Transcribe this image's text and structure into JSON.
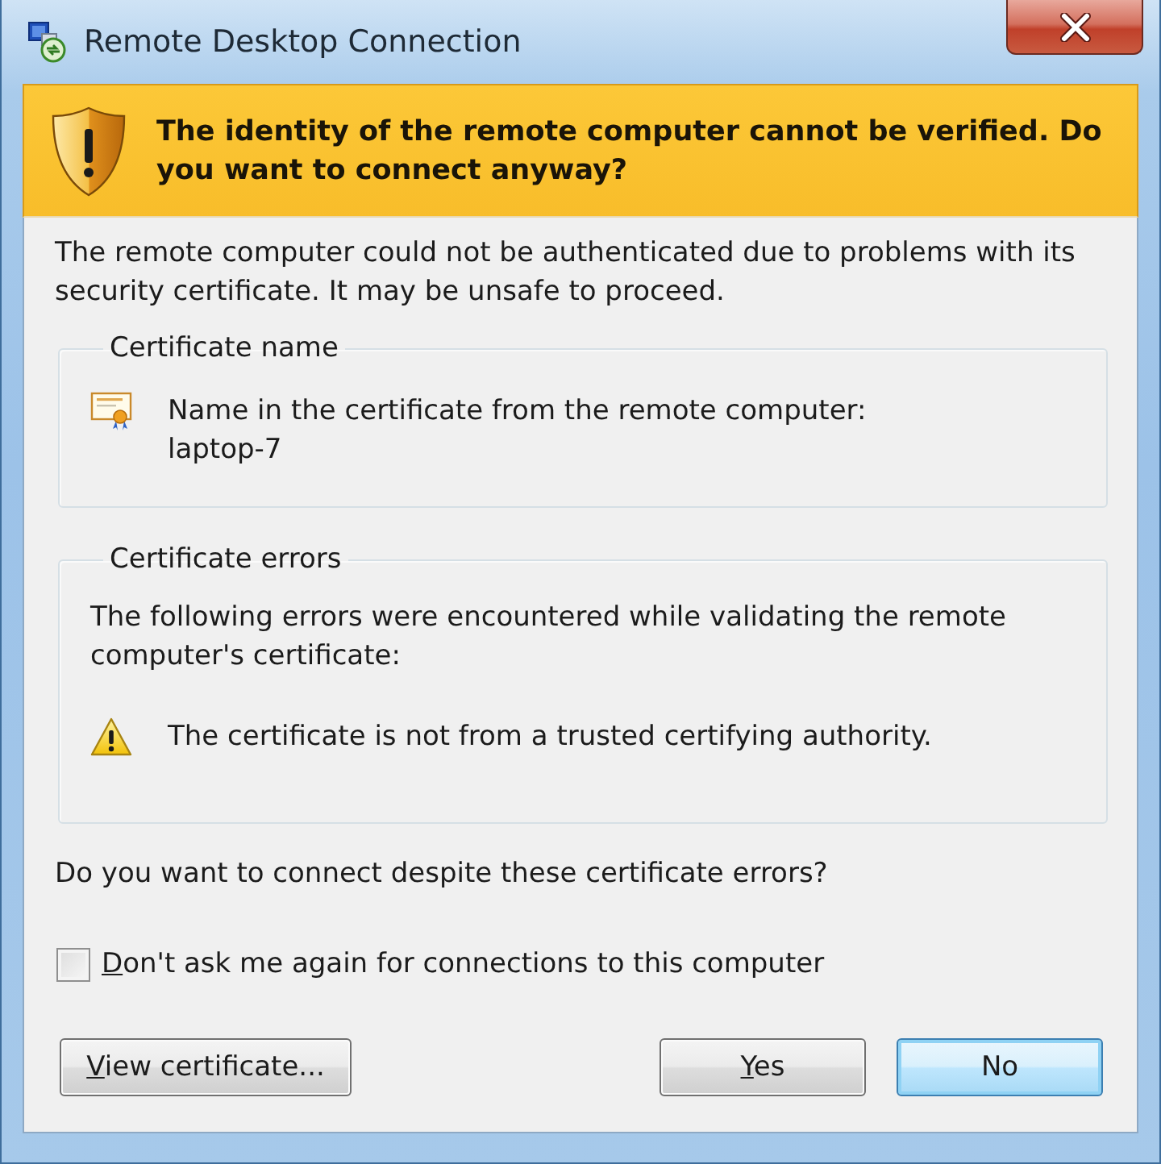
{
  "window": {
    "title": "Remote Desktop Connection"
  },
  "banner": {
    "text": "The identity of the remote computer cannot be verified. Do you want to connect anyway?"
  },
  "message": "The remote computer could not be authenticated due to problems with its security certificate. It may be unsafe to proceed.",
  "certificate_name": {
    "title": "Certificate name",
    "label": "Name in the certificate from the remote computer:",
    "value": "laptop-7"
  },
  "certificate_errors": {
    "title": "Certificate errors",
    "intro": "The following errors were encountered while validating the remote computer's certificate:",
    "errors": [
      "The certificate is not from a trusted certifying authority."
    ]
  },
  "question": "Do you want to connect despite these certificate errors?",
  "checkbox": {
    "label": "Don't ask me again for connections to this computer",
    "checked": false,
    "mnemonic_underlined": true
  },
  "buttons": [
    {
      "label": "View certificate...",
      "mnemonic_underlined": true,
      "default": false
    },
    {
      "label": "Yes",
      "mnemonic_underlined": true,
      "default": false
    },
    {
      "label": "No",
      "mnemonic_underlined": false,
      "default": true
    }
  ]
}
